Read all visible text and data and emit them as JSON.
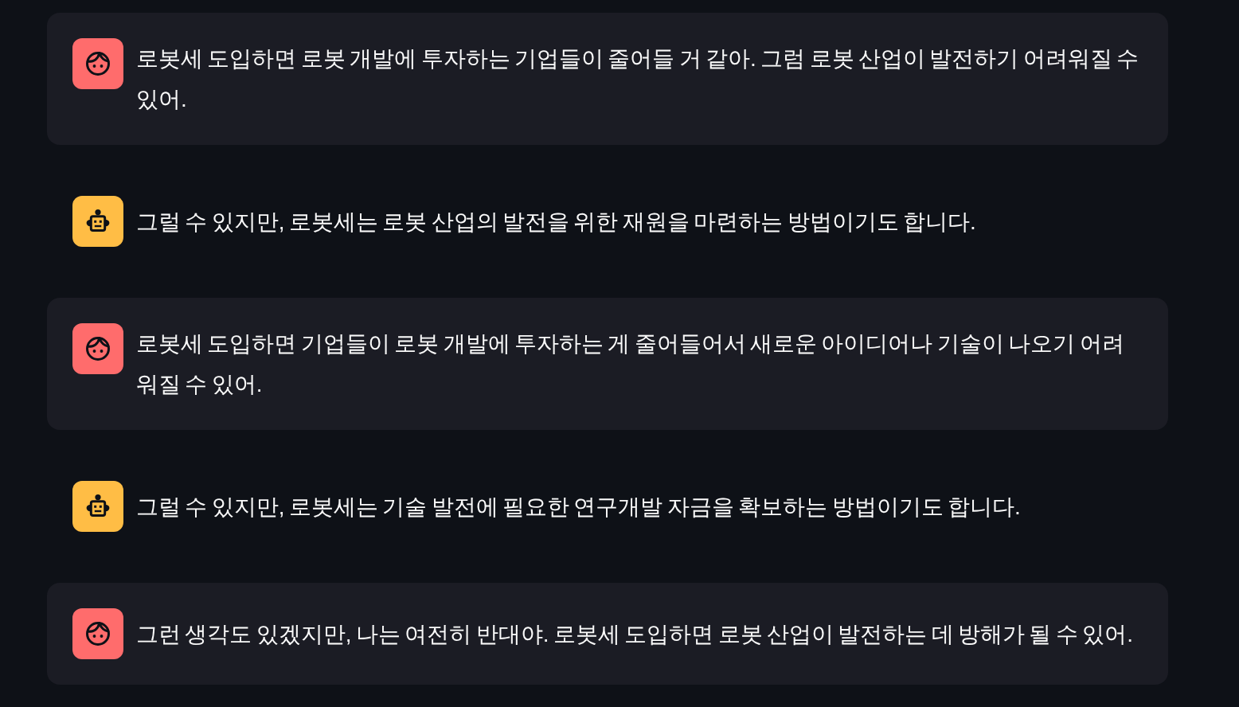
{
  "messages": [
    {
      "kind": "user",
      "text": "로봇세 도입하면 로봇 개발에 투자하는 기업들이 줄어들 거 같아. 그럼 로봇 산업이 발전하기 어려워질 수 있어."
    },
    {
      "kind": "assistant",
      "text": "그럴 수 있지만, 로봇세는 로봇 산업의 발전을 위한 재원을 마련하는 방법이기도 합니다."
    },
    {
      "kind": "user",
      "text": "로봇세 도입하면 기업들이 로봇 개발에 투자하는 게 줄어들어서 새로운 아이디어나 기술이 나오기 어려워질 수 있어."
    },
    {
      "kind": "assistant",
      "text": "그럴 수 있지만, 로봇세는 기술 발전에 필요한 연구개발 자금을 확보하는 방법이기도 합니다."
    },
    {
      "kind": "user",
      "text": "그런 생각도 있겠지만, 나는 여전히 반대야. 로봇세 도입하면 로봇 산업이 발전하는 데 방해가 될 수 있어."
    }
  ]
}
